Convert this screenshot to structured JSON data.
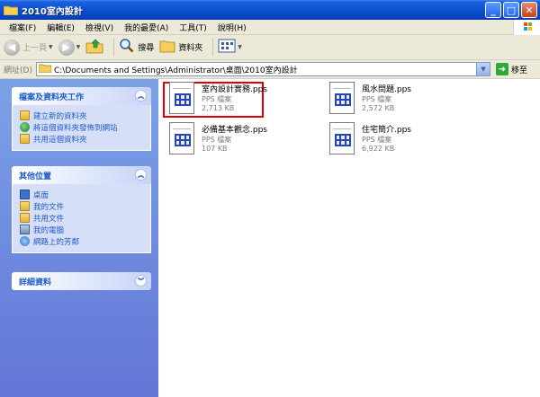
{
  "window": {
    "title": "2010室內設計"
  },
  "menu": [
    "檔案(F)",
    "編輯(E)",
    "檢視(V)",
    "我的最愛(A)",
    "工具(T)",
    "說明(H)"
  ],
  "toolbar": {
    "back_label": "上一頁",
    "search_label": "搜尋",
    "folders_label": "資料夾"
  },
  "address": {
    "label": "網址(D)",
    "value": "C:\\Documents and Settings\\Administrator\\桌面\\2010室內設計",
    "go_label": "移至"
  },
  "tasks": {
    "file_tasks": {
      "title": "檔案及資料夾工作",
      "items": [
        "建立新的資料夾",
        "將這個資料夾發佈到網站",
        "共用這個資料夾"
      ]
    },
    "other_places": {
      "title": "其他位置",
      "items": [
        "桌面",
        "我的文件",
        "共用文件",
        "我的電腦",
        "網路上的芳鄰"
      ]
    },
    "details": {
      "title": "詳細資料"
    }
  },
  "files": [
    {
      "name": "室內設計實務.pps",
      "type": "PPS 檔案",
      "size": "2,713 KB",
      "selected": true
    },
    {
      "name": "風水問題.pps",
      "type": "PPS 檔案",
      "size": "2,572 KB"
    },
    {
      "name": "必備基本觀念.pps",
      "type": "PPS 檔案",
      "size": "107 KB"
    },
    {
      "name": "住宅簡介.pps",
      "type": "PPS 檔案",
      "size": "6,922 KB"
    }
  ],
  "colors": {
    "titlebar": "#0a4fd0",
    "link": "#215dc6",
    "highlight": "#e00000"
  }
}
